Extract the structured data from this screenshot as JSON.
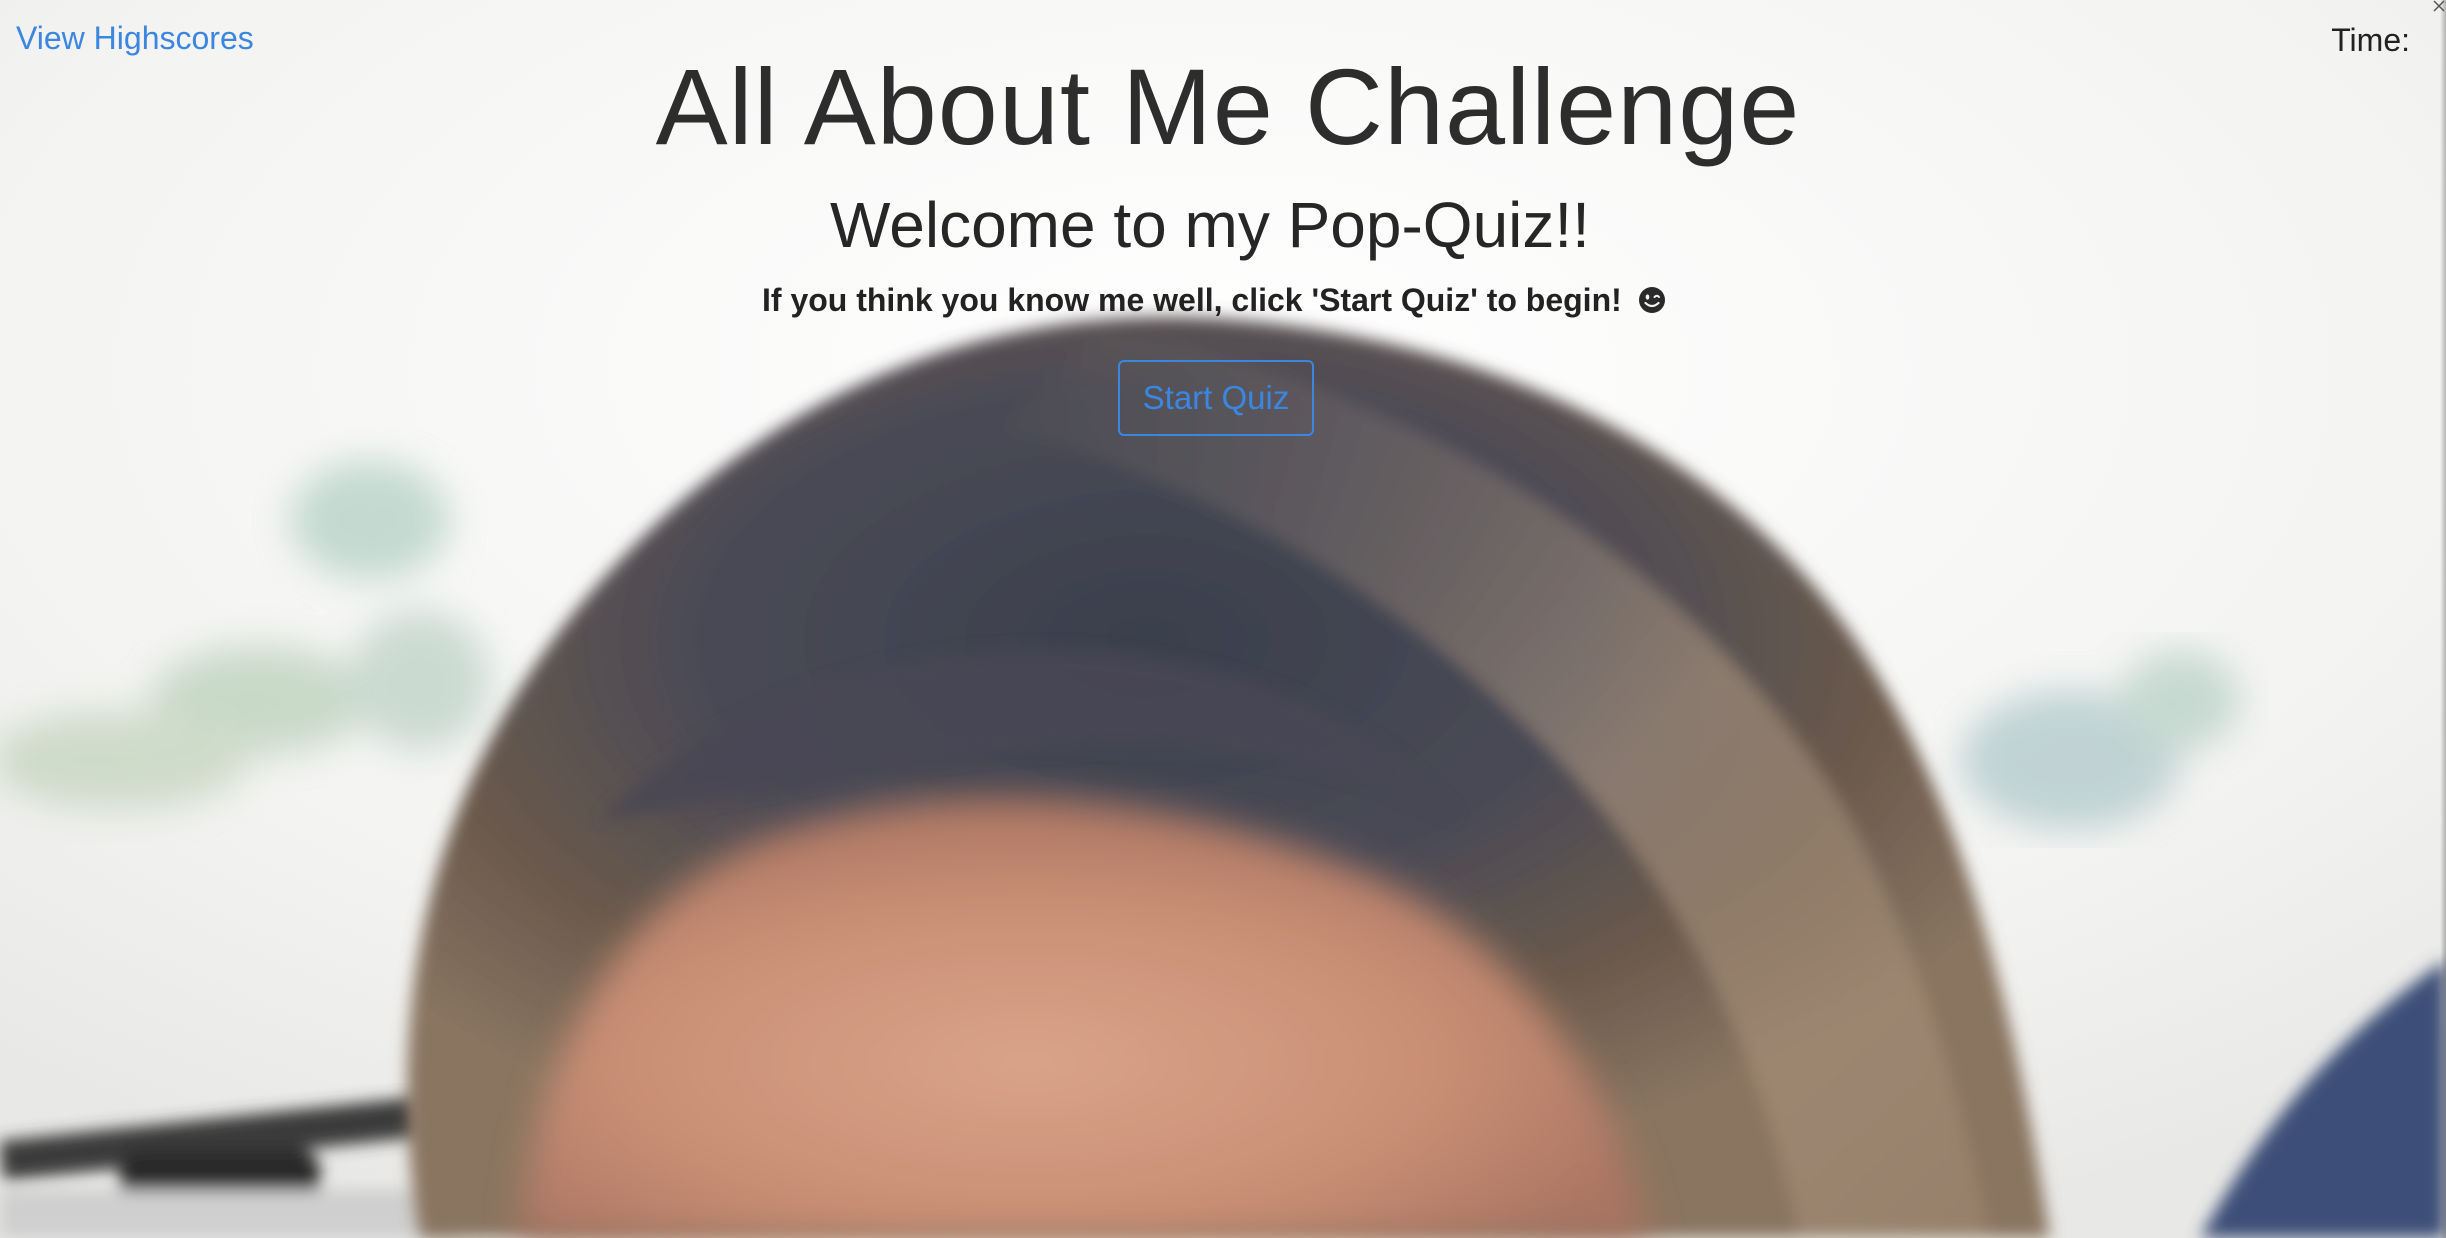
{
  "header": {
    "highscores_link": "View Highscores",
    "timer_label": "Time:",
    "timer_value": ""
  },
  "main": {
    "title": "All About Me Challenge",
    "welcome": "Welcome to my Pop-Quiz!!",
    "instructions": "If you think you know me well, click 'Start Quiz' to begin!",
    "start_button": "Start Quiz"
  },
  "icons": {
    "instruction_emoji": "smiling-face-icon"
  },
  "colors": {
    "link_accent": "#3b86e0",
    "text_dark": "#262626"
  }
}
